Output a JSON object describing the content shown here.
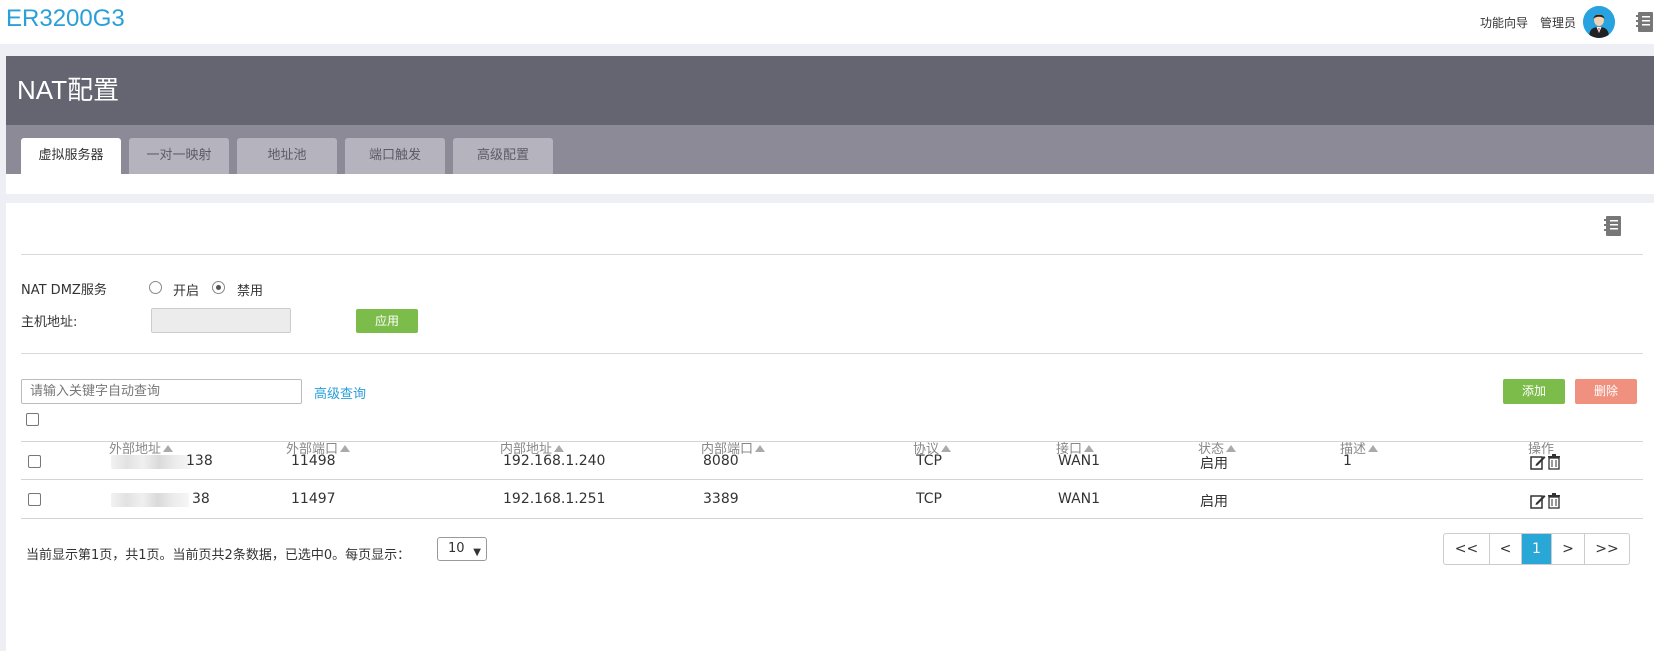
{
  "app": {
    "title": "ER3200G3"
  },
  "topnav": {
    "wizard": "功能向导",
    "admin": "管理员"
  },
  "page": {
    "title": "NAT配置"
  },
  "tabs": [
    {
      "label": "虚拟服务器",
      "active": true
    },
    {
      "label": "一对一映射",
      "active": false
    },
    {
      "label": "地址池",
      "active": false
    },
    {
      "label": "端口触发",
      "active": false
    },
    {
      "label": "高级配置",
      "active": false
    }
  ],
  "dmz": {
    "label": "NAT DMZ服务",
    "option_on": "开启",
    "option_off": "禁用",
    "selected": "禁用",
    "host_label": "主机地址:",
    "host_value": "",
    "apply_label": "应用"
  },
  "search": {
    "placeholder": "请输入关键字自动查询",
    "advanced_label": "高级查询"
  },
  "actions": {
    "add_label": "添加",
    "delete_label": "删除"
  },
  "table": {
    "headers": {
      "ext_addr": "外部地址",
      "ext_port": "外部端口",
      "int_addr": "内部地址",
      "int_port": "内部端口",
      "protocol": "协议",
      "interface": "接口",
      "status": "状态",
      "desc": "描述",
      "ops": "操作"
    },
    "rows": [
      {
        "ext_addr": "138",
        "ext_port": "11498",
        "int_addr": "192.168.1.240",
        "int_port": "8080",
        "protocol": "TCP",
        "interface": "WAN1",
        "status": "启用",
        "desc": "1"
      },
      {
        "ext_addr": "38",
        "ext_port": "11497",
        "int_addr": "192.168.1.251",
        "int_port": "3389",
        "protocol": "TCP",
        "interface": "WAN1",
        "status": "启用",
        "desc": ""
      }
    ]
  },
  "footer": {
    "summary": "当前显示第1页，共1页。当前页共2条数据，已选中0。每页显示：",
    "page_size": "10"
  },
  "pager": {
    "first": "<<",
    "prev": "<",
    "current": "1",
    "next": ">",
    "last": ">>"
  },
  "colors": {
    "brand": "#2a9fd8",
    "header_bg": "#646571",
    "tab_bar": "#8c8a96",
    "green": "#7cbc4a",
    "red": "#f0907e",
    "pager_active": "#29a7d6"
  }
}
